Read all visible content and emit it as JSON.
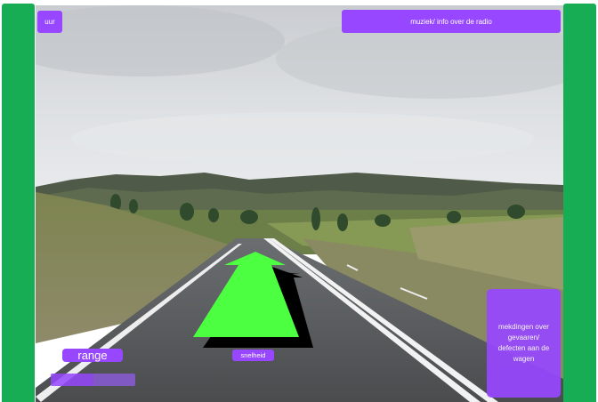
{
  "clock": {
    "label": "uur"
  },
  "radio": {
    "label": "muziek/ info over de radio"
  },
  "warnings": {
    "lines": [
      "mekdingen over",
      "gevaaren/",
      "defecten aan de",
      "wagen"
    ]
  },
  "range": {
    "label": "range",
    "fill_fraction": 0.5
  },
  "speed": {
    "label": "snelheid"
  },
  "colors": {
    "accent": "#9747ff",
    "side_panels": "#16ad54",
    "arrow": "#4cff41"
  }
}
